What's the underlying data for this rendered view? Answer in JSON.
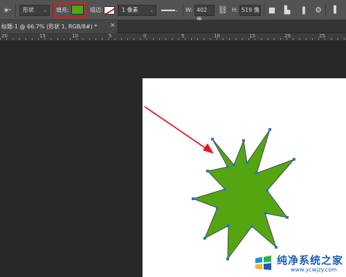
{
  "options_bar": {
    "tool_icon": "custom-shape-tool-icon",
    "mode_dropdown": "形状",
    "fill_label": "填充:",
    "fill_color": "#55a511",
    "stroke_label": "描边:",
    "stroke_color": "none",
    "stroke_width": "1 像素",
    "width_label": "W:",
    "width_value": "402 像",
    "link_icon": "link-icon",
    "height_label": "H:",
    "height_value": "519 像",
    "icons": [
      "path-operations-icon",
      "path-alignment-icon",
      "path-arrangement-icon",
      "gear-icon"
    ]
  },
  "tab": {
    "title": "标题-1 @ 66.7% (形状 1, RGB/8#) *",
    "close": "×"
  },
  "ruler": {
    "labels": [
      "20",
      "15",
      "10",
      "5",
      "0",
      "5",
      "10",
      "15",
      "20",
      "25"
    ]
  },
  "watermark": {
    "name": "纯净系统之家",
    "url": "www.ycwjzy.com"
  },
  "colors": {
    "shape_fill": "#55a511",
    "shape_outline": "#3b4a5e",
    "anchor": "#1f78d2",
    "annotation": "#e0191c"
  }
}
